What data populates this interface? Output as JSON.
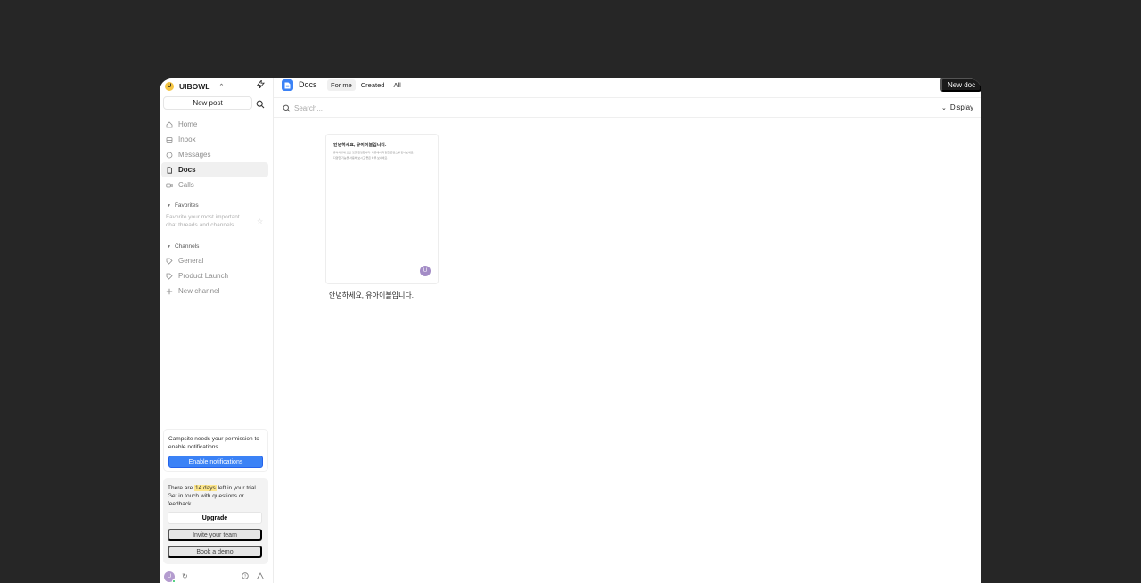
{
  "sidebar": {
    "org_name": "UIBOWL",
    "org_initial": "U",
    "new_post_label": "New post",
    "nav": [
      {
        "label": "Home",
        "icon": "home-icon"
      },
      {
        "label": "Inbox",
        "icon": "inbox-icon"
      },
      {
        "label": "Messages",
        "icon": "message-icon"
      },
      {
        "label": "Docs",
        "icon": "doc-icon",
        "active": true
      },
      {
        "label": "Calls",
        "icon": "video-icon"
      }
    ],
    "favorites": {
      "title": "Favorites",
      "note": "Favorite your most important chat threads and channels."
    },
    "channels": {
      "title": "Channels",
      "items": [
        "General",
        "Product Launch"
      ],
      "new_channel_label": "New channel"
    },
    "notify_card": {
      "text": "Campsite needs your permission to enable notifications.",
      "button_label": "Enable notifications"
    },
    "trial_card": {
      "text_before": "There are ",
      "highlight": "14 days",
      "text_after": " left in your trial. Get in touch with questions or feedback.",
      "upgrade_label": "Upgrade",
      "invite_label": "Invite your team",
      "demo_label": "Book a demo"
    },
    "user_initial": "U"
  },
  "main": {
    "title": "Docs",
    "tabs": [
      "For me",
      "Created",
      "All"
    ],
    "active_tab": "For me",
    "new_doc_label": "New doc",
    "search_placeholder": "Search...",
    "display_label": "Display",
    "docs": [
      {
        "title": "안녕하세요, 유아이볼입니다.",
        "preview_title": "안녕하세요, 유아이볼입니다.",
        "preview_lines": [
          "유아이볼에 오신 것을 환영합니다. 이곳에서 다양한 콘텐츠를 만나보세요.",
          "다양한 기능을 사용해 보시고 좋은 하루 보내세요."
        ],
        "author_initial": "U"
      }
    ]
  },
  "colors": {
    "accent": "#3b82f6",
    "background": "#262626",
    "highlight": "#fde68a"
  }
}
